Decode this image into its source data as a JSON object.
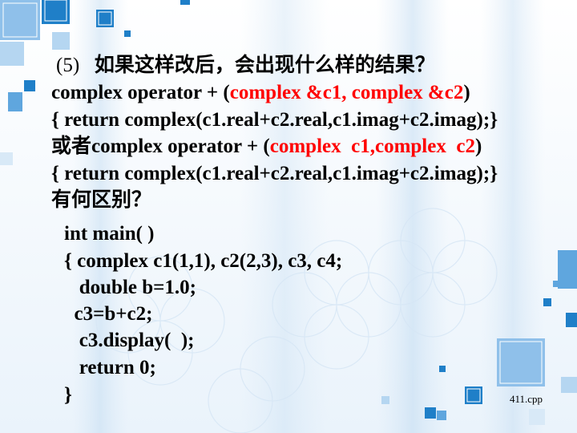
{
  "slide": {
    "question": {
      "number": "(5)",
      "text": "如果这样改后，会出现什么样的结果？"
    },
    "line1": {
      "a": "complex operator + (",
      "b": "complex &c1, complex &c2",
      "c": ")"
    },
    "line2": "{ return complex(c1.real+c2.real,c1.imag+c2.imag);}",
    "line3": {
      "a": "或者complex operator + (",
      "b": "complex  c1,complex  c2",
      "c": ")"
    },
    "line4": "{ return complex(c1.real+c2.real,c1.imag+c2.imag);}",
    "line5": "有何区别？",
    "code": [
      "int main( )",
      "{ complex c1(1,1), c2(2,3), c3, c4;",
      "   double b=1.0;",
      "  c3=b+c2;",
      "   c3.display(  );",
      "   return 0;",
      "}"
    ],
    "filename": "411.cpp"
  },
  "colors": {
    "highlight": "#ff0000",
    "accent": "#1f7fc8"
  }
}
